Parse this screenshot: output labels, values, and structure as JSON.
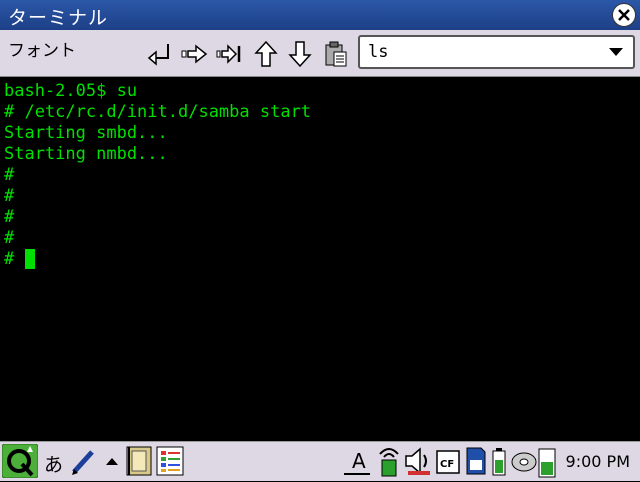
{
  "window": {
    "title": "ターミナル"
  },
  "toolbar": {
    "font_menu": "フォント",
    "command_combo": {
      "value": "ls"
    }
  },
  "terminal": {
    "lines": [
      "bash-2.05$ su",
      "# /etc/rc.d/init.d/samba start",
      "Starting smbd...",
      "Starting nmbd...",
      "#",
      "#",
      "#",
      "#",
      "# "
    ],
    "text_color": "#00e000",
    "background": "#000000"
  },
  "taskbar": {
    "input_mode": "あ",
    "clock": "9:00 PM",
    "cf_label": "CF"
  },
  "colors": {
    "titlebar": "#1d3f87",
    "toolbar_bg": "#ddd8e4"
  }
}
